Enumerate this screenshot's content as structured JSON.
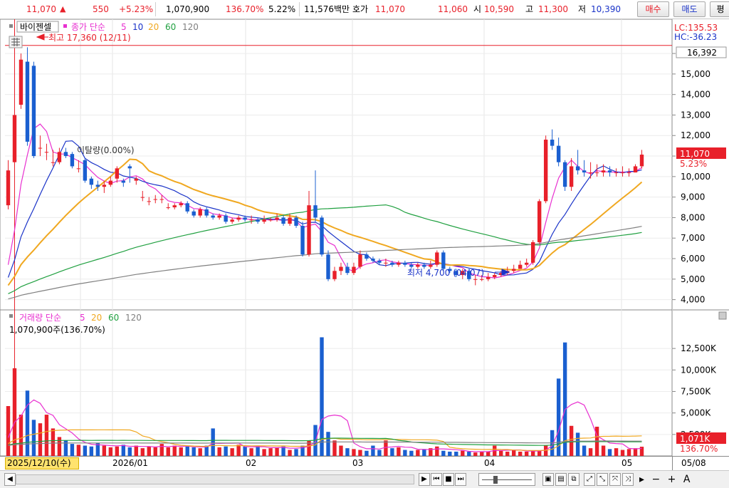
{
  "toolbar": {
    "price": "11,070",
    "change_arrow": "▲",
    "change": "550",
    "change_pct": "+5.23%",
    "volume": "1,070,900",
    "vol_ratio": "136.70%",
    "turnover": "5.22%",
    "amount": "11,576백만",
    "bid_label": "호가",
    "ask_price": "11,070",
    "bid_price": "11,060",
    "open_label": "시",
    "open": "10,590",
    "high_label": "고",
    "high": "11,300",
    "low_label": "저",
    "low": "10,390",
    "buy_label": "매수",
    "sell_label": "매도",
    "extra_label": "평"
  },
  "price_panel": {
    "stock_name": "바이젠셀",
    "ma_label": "종가 단순",
    "ma_periods": [
      "5",
      "10",
      "20",
      "60",
      "120"
    ],
    "lc": "LC:135.53",
    "hc": "HC:-36.23",
    "high_annotation": "최고 17,360 (12/11)",
    "low_annotation": "최저 4,700 (04/07)",
    "disparity": "이탈량(0.00%)",
    "hline_value": "16,392",
    "last_price": "11,070",
    "last_pct": "5.23%",
    "y_ticks": [
      "4,000",
      "5,000",
      "6,000",
      "7,000",
      "8,000",
      "9,000",
      "10,000",
      "11,000",
      "12,000",
      "13,000",
      "14,000",
      "15,000",
      "16,000"
    ]
  },
  "volume_panel": {
    "title": "거래량 단순",
    "ma_periods": [
      "5",
      "20",
      "60",
      "120"
    ],
    "current": "1,070,900주(136.70%)",
    "last_volume": "1,071K",
    "last_pct": "136.70%",
    "y_ticks": [
      "2,500K",
      "5,000K",
      "7,500K",
      "10,000K",
      "12,500K"
    ]
  },
  "x_axis": {
    "cursor_date": "2025/12/10(수)",
    "labels": [
      "2026/01",
      "02",
      "03",
      "04",
      "05"
    ],
    "right_label": "05/08"
  },
  "colors": {
    "up": "#e8202a",
    "down": "#1a5fd0",
    "ma5": "#e830d0",
    "ma10": "#1a33c8",
    "ma20": "#f0a820",
    "ma60": "#20a040",
    "ma120": "#808080",
    "hline": "#e8202a"
  },
  "chart_data": [
    {
      "type": "candlestick",
      "title": "바이젠셀",
      "x": [
        "2025-12-09",
        "2025-12-10",
        "2025-12-11",
        "2025-12-12",
        "2025-12-15",
        "2025-12-16",
        "2025-12-17",
        "2025-12-18",
        "2025-12-19",
        "2025-12-22",
        "2025-12-23",
        "2025-12-24",
        "2025-12-26",
        "2025-12-29",
        "2025-12-30",
        "2026-01-02",
        "2026-01-05",
        "2026-01-06",
        "2026-01-07",
        "2026-01-08",
        "2026-01-09",
        "2026-01-12",
        "2026-01-13",
        "2026-01-14",
        "2026-01-15",
        "2026-01-16",
        "2026-01-19",
        "2026-01-20",
        "2026-01-21",
        "2026-01-22",
        "2026-01-23",
        "2026-01-26",
        "2026-01-27",
        "2026-01-28",
        "2026-01-29",
        "2026-01-30",
        "2026-02-02",
        "2026-02-03",
        "2026-02-04",
        "2026-02-05",
        "2026-02-06",
        "2026-02-09",
        "2026-02-10",
        "2026-02-11",
        "2026-02-12",
        "2026-02-13",
        "2026-02-19",
        "2026-02-20",
        "2026-02-23",
        "2026-02-24",
        "2026-02-25",
        "2026-02-26",
        "2026-02-27",
        "2026-03-03",
        "2026-03-04",
        "2026-03-05",
        "2026-03-06",
        "2026-03-09",
        "2026-03-10",
        "2026-03-11",
        "2026-03-12",
        "2026-03-13",
        "2026-03-16",
        "2026-03-17",
        "2026-03-18",
        "2026-03-19",
        "2026-03-20",
        "2026-03-23",
        "2026-03-24",
        "2026-03-25",
        "2026-03-26",
        "2026-03-27",
        "2026-03-30",
        "2026-03-31",
        "2026-04-01",
        "2026-04-02",
        "2026-04-03",
        "2026-04-06",
        "2026-04-07",
        "2026-04-08",
        "2026-04-09",
        "2026-04-10",
        "2026-04-13",
        "2026-04-14",
        "2026-04-15",
        "2026-04-16",
        "2026-04-17",
        "2026-04-20",
        "2026-04-21",
        "2026-04-22",
        "2026-04-23",
        "2026-04-24",
        "2026-04-27",
        "2026-04-28",
        "2026-04-29",
        "2026-04-30",
        "2026-05-04",
        "2026-05-06",
        "2026-05-07",
        "2026-05-08"
      ],
      "open": [
        8600,
        10700,
        13500,
        15600,
        15400,
        11400,
        11200,
        10700,
        10700,
        11200,
        11100,
        10400,
        10800,
        9900,
        9600,
        9500,
        9600,
        9900,
        9800,
        10500,
        9800,
        9000,
        8800,
        8900,
        8900,
        8500,
        8500,
        8600,
        8700,
        8300,
        8100,
        8400,
        8100,
        8000,
        8100,
        7800,
        7900,
        8000,
        7900,
        7900,
        7800,
        7900,
        7900,
        8000,
        7700,
        8000,
        7600,
        6200,
        8600,
        8000,
        6200,
        5000,
        5400,
        5600,
        5300,
        5600,
        6200,
        6000,
        5900,
        5800,
        5800,
        5700,
        5800,
        5700,
        5600,
        5700,
        5600,
        5700,
        6300,
        5500,
        5400,
        5200,
        5400,
        5000,
        5000,
        5000,
        5100,
        5200,
        5300,
        5400,
        5500,
        5700,
        5800,
        6800,
        8800,
        11800,
        11500,
        10700,
        9500,
        10500,
        10300,
        10200,
        10200,
        10200,
        10300,
        10200,
        10200,
        10200,
        10200,
        10500
      ],
      "close": [
        10300,
        13000,
        15700,
        11700,
        11000,
        11400,
        11200,
        10700,
        11200,
        11000,
        10500,
        10400,
        9800,
        9600,
        9500,
        9600,
        9800,
        10400,
        9700,
        10400,
        9900,
        9000,
        8800,
        8900,
        8900,
        8500,
        8600,
        8700,
        8300,
        8100,
        8400,
        8100,
        8000,
        8100,
        7800,
        7900,
        8000,
        7900,
        7900,
        7800,
        7900,
        7900,
        8000,
        7700,
        8000,
        7600,
        6200,
        8600,
        8000,
        6200,
        5000,
        5400,
        5600,
        5300,
        5600,
        6200,
        6000,
        5900,
        5800,
        5800,
        5700,
        5800,
        5700,
        5600,
        5700,
        5600,
        5700,
        6300,
        5500,
        5400,
        5200,
        5400,
        5000,
        5000,
        5000,
        5100,
        5200,
        5300,
        5400,
        5500,
        5700,
        5800,
        6800,
        8800,
        11800,
        11500,
        10700,
        9500,
        10500,
        10300,
        10200,
        10200,
        10200,
        10300,
        10200,
        10200,
        10200,
        10200,
        10500,
        11070
      ],
      "high": [
        10800,
        17360,
        16000,
        16300,
        15600,
        12000,
        11600,
        11300,
        11400,
        11400,
        11200,
        10800,
        10900,
        10000,
        9800,
        9800,
        10000,
        10500,
        9900,
        10600,
        10000,
        9300,
        9000,
        9100,
        9100,
        8700,
        8700,
        8800,
        8800,
        8400,
        8500,
        8500,
        8200,
        8200,
        8200,
        8000,
        8100,
        8100,
        8100,
        8000,
        8100,
        8000,
        8200,
        8100,
        8200,
        8100,
        7800,
        9300,
        10300,
        8100,
        6400,
        5600,
        5800,
        5800,
        5800,
        6400,
        6300,
        6100,
        6000,
        6000,
        5900,
        5900,
        5900,
        5800,
        5800,
        5800,
        5900,
        6400,
        6400,
        5600,
        5500,
        5500,
        5500,
        5200,
        5200,
        5300,
        5300,
        5400,
        5600,
        5700,
        5900,
        6000,
        6900,
        8900,
        12000,
        12300,
        11900,
        10800,
        10900,
        11300,
        10800,
        10700,
        10600,
        10600,
        10500,
        10400,
        10500,
        10400,
        10600,
        11300
      ],
      "low": [
        8400,
        10500,
        13300,
        11500,
        10900,
        11000,
        10800,
        10500,
        10600,
        10900,
        10400,
        10200,
        9700,
        9400,
        9300,
        9200,
        9500,
        9700,
        9500,
        9700,
        9600,
        8800,
        8600,
        8700,
        8700,
        8400,
        8400,
        8500,
        8200,
        8000,
        8000,
        8000,
        7900,
        7900,
        7700,
        7700,
        7800,
        7800,
        7700,
        7700,
        7700,
        7800,
        7800,
        7600,
        7600,
        7500,
        6100,
        6100,
        7800,
        6100,
        4900,
        4900,
        5200,
        5200,
        5200,
        5500,
        5900,
        5800,
        5700,
        5600,
        5600,
        5600,
        5600,
        5500,
        5500,
        5500,
        5500,
        5600,
        5400,
        5300,
        5100,
        5000,
        4900,
        4700,
        4900,
        4900,
        5000,
        5100,
        5200,
        5300,
        5500,
        5600,
        5700,
        6700,
        8700,
        11300,
        10500,
        9300,
        9300,
        10100,
        10000,
        9900,
        10000,
        10000,
        10000,
        10000,
        10000,
        10000,
        10200,
        10390
      ],
      "ylim": [
        3500,
        17600
      ],
      "ma_periods": [
        5,
        10,
        20,
        60,
        120
      ],
      "hline": 16392
    },
    {
      "type": "bar",
      "title": "거래량",
      "series": [
        {
          "name": "거래량",
          "values": [
            5800,
            10200,
            4800,
            7600,
            4200,
            3800,
            4800,
            3200,
            2200,
            1800,
            1400,
            1300,
            1200,
            1100,
            1500,
            1200,
            1000,
            1100,
            1300,
            1000,
            1200,
            900,
            1100,
            1000,
            1400,
            1000,
            1200,
            1000,
            1100,
            1000,
            900,
            1200,
            3200,
            1000,
            1100,
            900,
            1300,
            1100,
            900,
            1200,
            800,
            900,
            1000,
            1100,
            700,
            800,
            1200,
            1800,
            3600,
            13800,
            2800,
            1800,
            1200,
            900,
            800,
            700,
            600,
            1200,
            700,
            1800,
            900,
            1000,
            700,
            600,
            700,
            800,
            900,
            1100,
            600,
            500,
            500,
            600,
            500,
            400,
            500,
            500,
            1200,
            600,
            500,
            700,
            500,
            500,
            600,
            600,
            1200,
            3000,
            9000,
            13200,
            3500,
            2700,
            1200,
            900,
            3400,
            1200,
            800,
            900,
            700,
            800,
            900,
            1071
          ]
        }
      ],
      "ylim": [
        0,
        14500
      ],
      "unit": "K"
    }
  ]
}
